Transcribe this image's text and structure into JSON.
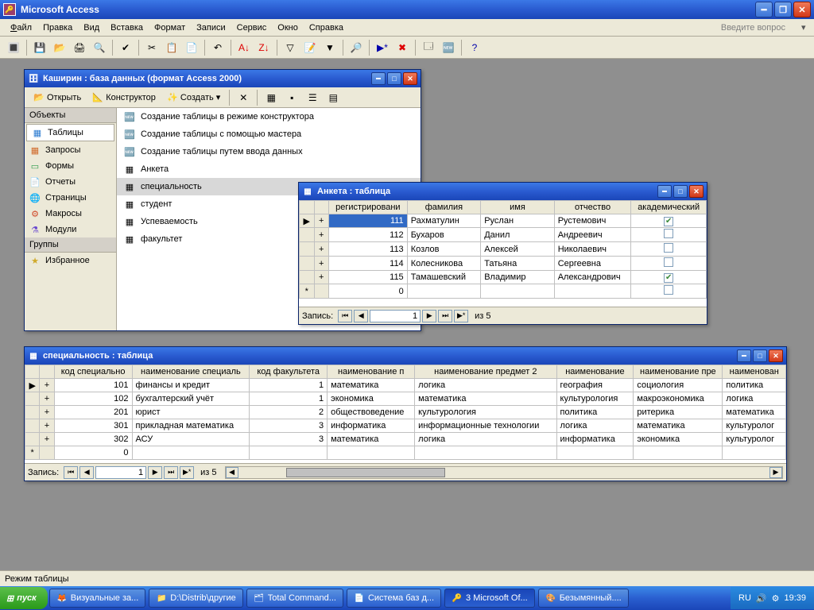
{
  "app": {
    "title": "Microsoft Access"
  },
  "menu": {
    "file": "Файл",
    "edit": "Правка",
    "view": "Вид",
    "insert": "Вставка",
    "format": "Формат",
    "records": "Записи",
    "service": "Сервис",
    "window": "Окно",
    "help": "Справка",
    "question": "Введите вопрос"
  },
  "dbwin": {
    "title": "Каширин : база данных (формат Access 2000)",
    "open": "Открыть",
    "design": "Конструктор",
    "create": "Создать",
    "objects": "Объекты",
    "tables": "Таблицы",
    "queries": "Запросы",
    "forms": "Формы",
    "reports": "Отчеты",
    "pages": "Страницы",
    "macros": "Макросы",
    "modules": "Модули",
    "groups": "Группы",
    "fav": "Избранное",
    "list": {
      "new_design": "Создание таблицы в режиме конструктора",
      "new_wizard": "Создание таблицы с помощью мастера",
      "new_data": "Создание таблицы путем ввода данных",
      "anketa": "Анкета",
      "spec": "специальность",
      "student": "студент",
      "usp": "Успеваемость",
      "fac": "факультет"
    }
  },
  "anketa": {
    "title": "Анкета : таблица",
    "cols": {
      "reg": "регистрировани",
      "fam": "фамилия",
      "imya": "имя",
      "otch": "отчество",
      "akad": "академический"
    },
    "rows": [
      {
        "reg": "111",
        "fam": "Рахматулин",
        "imya": "Руслан",
        "otch": "Рустемович",
        "akad": true
      },
      {
        "reg": "112",
        "fam": "Бухаров",
        "imya": "Данил",
        "otch": "Андреевич",
        "akad": false
      },
      {
        "reg": "113",
        "fam": "Козлов",
        "imya": "Алексей",
        "otch": "Николаевич",
        "akad": false
      },
      {
        "reg": "114",
        "fam": "Колесникова",
        "imya": "Татьяна",
        "otch": "Сергеевна",
        "akad": false
      },
      {
        "reg": "115",
        "fam": "Тамашевский",
        "imya": "Владимир",
        "otch": "Александрович",
        "akad": true
      }
    ],
    "newrow_reg": "0",
    "rec_label": "Запись:",
    "rec_cur": "1",
    "rec_of": "из  5"
  },
  "spec": {
    "title": "специальность : таблица",
    "cols": {
      "kod": "код специально",
      "naim": "наименование специаль",
      "kodfac": "код факультета",
      "p1": "наименование п",
      "p2": "наименование предмет 2",
      "n3": "наименование",
      "p3": "наименование пре",
      "n4": "наименован"
    },
    "rows": [
      {
        "kod": "101",
        "naim": "финансы и кредит",
        "kodfac": "1",
        "p1": "математика",
        "p2": "логика",
        "n3": "география",
        "p3": "социология",
        "n4": "политика"
      },
      {
        "kod": "102",
        "naim": "бухгалтерский учёт",
        "kodfac": "1",
        "p1": "экономика",
        "p2": "математика",
        "n3": "культурология",
        "p3": "макроэкономика",
        "n4": "логика"
      },
      {
        "kod": "201",
        "naim": "юрист",
        "kodfac": "2",
        "p1": "обществоведение",
        "p2": "культурология",
        "n3": "политика",
        "p3": "ритерика",
        "n4": "математика"
      },
      {
        "kod": "301",
        "naim": "прикладная математика",
        "kodfac": "3",
        "p1": "информатика",
        "p2": "информационные технологии",
        "n3": "логика",
        "p3": "математика",
        "n4": "культуролог"
      },
      {
        "kod": "302",
        "naim": "АСУ",
        "kodfac": "3",
        "p1": "математика",
        "p2": "логика",
        "n3": "информатика",
        "p3": "экономика",
        "n4": "культуролог"
      }
    ],
    "newrow_kod": "0",
    "rec_label": "Запись:",
    "rec_cur": "1",
    "rec_of": "из  5"
  },
  "status": "Режим таблицы",
  "taskbar": {
    "start": "пуск",
    "items": [
      {
        "label": "Визуальные за..."
      },
      {
        "label": "D:\\Distrib\\другие"
      },
      {
        "label": "Total Command..."
      },
      {
        "label": "Система баз д..."
      },
      {
        "label": "3 Microsoft Of...",
        "active": true
      },
      {
        "label": "Безымянный...."
      }
    ],
    "lang": "RU",
    "time": "19:39"
  }
}
